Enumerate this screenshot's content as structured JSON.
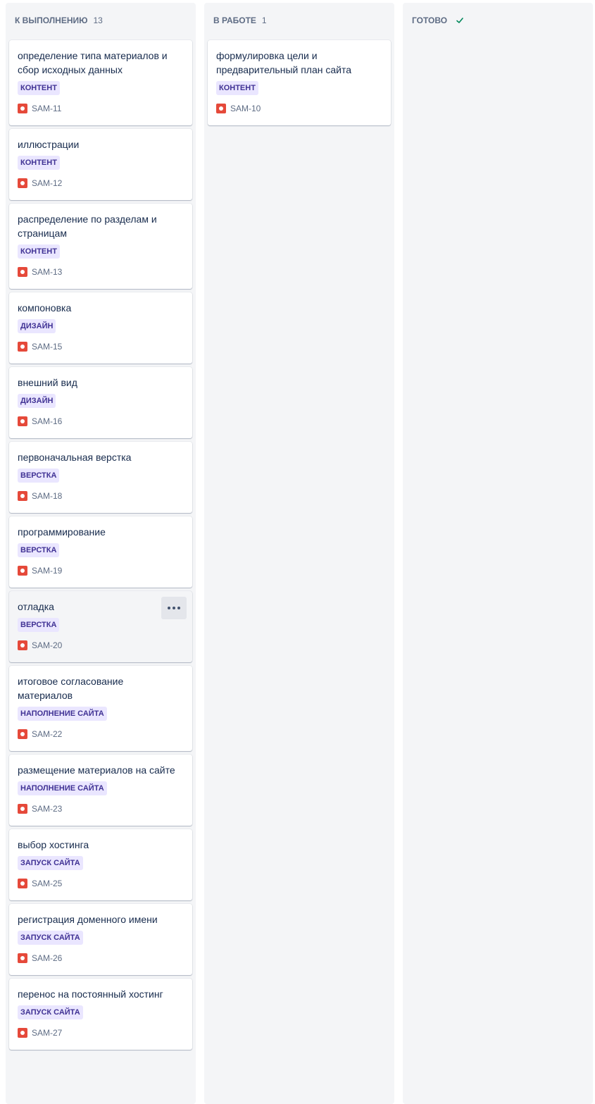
{
  "columns": [
    {
      "title": "К ВЫПОЛНЕНИЮ",
      "count": "13",
      "cards": [
        {
          "title": "определение типа материалов и сбор исходных данных",
          "epic": "КОНТЕНТ",
          "key": "SAM-11"
        },
        {
          "title": "иллюстрации",
          "epic": "КОНТЕНТ",
          "key": "SAM-12"
        },
        {
          "title": "распределение по разделам и страницам",
          "epic": "КОНТЕНТ",
          "key": "SAM-13"
        },
        {
          "title": "компоновка",
          "epic": "ДИЗАЙН",
          "key": "SAM-15"
        },
        {
          "title": "внешний вид",
          "epic": "ДИЗАЙН",
          "key": "SAM-16"
        },
        {
          "title": "первоначальная верстка",
          "epic": "ВЕРСТКА",
          "key": "SAM-18"
        },
        {
          "title": "программирование",
          "epic": "ВЕРСТКА",
          "key": "SAM-19"
        },
        {
          "title": "отладка",
          "epic": "ВЕРСТКА",
          "key": "SAM-20",
          "hovered": true
        },
        {
          "title": "итоговое согласование материалов",
          "epic": "НАПОЛНЕНИЕ САЙТА",
          "key": "SAM-22"
        },
        {
          "title": "размещение материалов на сайте",
          "epic": "НАПОЛНЕНИЕ САЙТА",
          "key": "SAM-23"
        },
        {
          "title": "выбор хостинга",
          "epic": "ЗАПУСК САЙТА",
          "key": "SAM-25"
        },
        {
          "title": "регистрация доменного имени",
          "epic": "ЗАПУСК САЙТА",
          "key": "SAM-26"
        },
        {
          "title": "перенос на постоянный хостинг",
          "epic": "ЗАПУСК САЙТА",
          "key": "SAM-27"
        }
      ]
    },
    {
      "title": "В РАБОТЕ",
      "count": "1",
      "cards": [
        {
          "title": "формулировка цели и предварительный план сайта",
          "epic": "КОНТЕНТ",
          "key": "SAM-10"
        }
      ]
    },
    {
      "title": "ГОТОВО",
      "count": "",
      "done_icon": "check-icon",
      "cards": []
    }
  ],
  "colors": {
    "column_bg": "#f4f5f7",
    "epic_bg": "#eae6ff",
    "epic_text": "#403294",
    "bug_icon": "#e5493a",
    "done_check": "#00875a"
  },
  "card_menu_icon": "more-icon",
  "issue_type_icon": "bug-icon"
}
